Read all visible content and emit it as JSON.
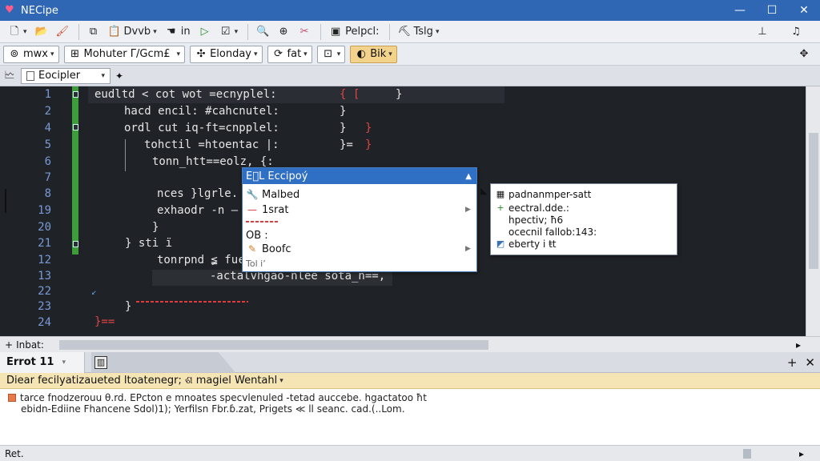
{
  "window": {
    "title": "NECipe",
    "controls": [
      "—",
      "☐",
      "✕"
    ]
  },
  "toolbar1": {
    "items": [
      {
        "icon": "new-file-icon",
        "glyph": "🗋",
        "caret": true
      },
      {
        "icon": "open-folder-icon",
        "glyph": "📂"
      },
      {
        "icon": "paint-icon",
        "glyph": "🖌"
      },
      {
        "icon": "copy-icon",
        "glyph": "⧉"
      },
      {
        "icon": "clipboard-icon",
        "glyph": "📋",
        "label": "Dvvb",
        "caret": true
      },
      {
        "icon": "hand-icon",
        "glyph": "☚",
        "label": "in"
      },
      {
        "icon": "run-icon",
        "glyph": "▷"
      },
      {
        "icon": "checklist-icon",
        "glyph": "☑",
        "caret": true
      },
      {
        "icon": "search-icon",
        "glyph": "🔍"
      },
      {
        "icon": "replace-icon",
        "glyph": "⊕"
      },
      {
        "icon": "tools-icon",
        "glyph": "✂"
      },
      {
        "icon": "panel-icon",
        "glyph": "▣",
        "label": "Pelpcl:"
      },
      {
        "icon": "build-icon",
        "glyph": "⛏",
        "label": "Tslg",
        "caret": true
      }
    ],
    "right_icons": [
      {
        "icon": "pin-icon",
        "glyph": "⊥"
      },
      {
        "icon": "music-icon",
        "glyph": "♫"
      }
    ]
  },
  "toolbar2": {
    "items": [
      {
        "icon": "target-icon",
        "glyph": "⊚",
        "label": "mwx",
        "caret": true
      },
      {
        "icon": "module-icon",
        "glyph": "⊞",
        "label": "Mohuter Γ/Gcm£",
        "caret": true
      },
      {
        "icon": "gear-icon",
        "glyph": "✣",
        "label": "Elonday",
        "caret": true
      },
      {
        "icon": "refresh-icon",
        "glyph": "⟳",
        "label": "fat",
        "caret": true
      },
      {
        "icon": "grid-icon",
        "glyph": "⊡",
        "caret": true
      },
      {
        "icon": "flame-icon",
        "glyph": "◐",
        "label": "Bik",
        "caret": true,
        "highlight": true
      }
    ],
    "right_icon": {
      "icon": "move-icon",
      "glyph": "✥"
    }
  },
  "tabs": {
    "left_icon": "🗠",
    "active": "Eocipler",
    "pin": "✦"
  },
  "editor": {
    "lines": [
      {
        "n": "1",
        "text": "eudltd < cot wot =ecnyplel:",
        "extra": "{ [",
        "extra2": "}"
      },
      {
        "n": "2",
        "text": "hacd encil: #cahcnutel:",
        "extra": "}"
      },
      {
        "n": "4",
        "text": "ordl cut iq-ft=cnpplel:",
        "extra": "}"
      },
      {
        "n": "5",
        "text": "tohctil =htoentac |:",
        "extra": "}="
      },
      {
        "n": "6",
        "text": "tonn_htt==eolz, {:",
        "extra": ""
      },
      {
        "n": "7",
        "text": "",
        "extra": ""
      },
      {
        "n": "8",
        "text": "nces }lgrle.",
        "extra": ""
      },
      {
        "n": "19",
        "text": "exhaodr -n —",
        "extra": ""
      },
      {
        "n": "20",
        "text": "}",
        "extra": ""
      },
      {
        "n": "21",
        "text": "} ѕti ï",
        "extra": ""
      },
      {
        "n": "12",
        "text": "tonrpnd ≨ fuє",
        "extra": ""
      },
      {
        "n": "13",
        "text": "-actalvhgao-nlee sota_n==,",
        "extra": ""
      },
      {
        "n": "22",
        "text": "",
        "extra": ""
      },
      {
        "n": "23",
        "text": "}",
        "extra": ""
      },
      {
        "n": "24",
        "text": "",
        "extra": ""
      },
      {
        "n": "",
        "text": "}==",
        "extra": ""
      }
    ]
  },
  "autocomplete": {
    "header": "E⃝L Eccipoý",
    "items": [
      {
        "icon": "wrench-icon",
        "glyph": "🔧",
        "label": "Malbed"
      },
      {
        "icon": "dash-icon",
        "glyph": "—",
        "label": "1srat",
        "submenu": true
      },
      {
        "icon": "",
        "glyph": "",
        "label": "OB :"
      },
      {
        "icon": "edit-icon",
        "glyph": "✎",
        "label": "Boofc",
        "submenu": true
      },
      {
        "icon": "",
        "glyph": "",
        "label": "Tol iʼ"
      }
    ]
  },
  "doc_tooltip": {
    "lines": [
      {
        "icon": "class-icon",
        "glyph": "▦",
        "text": "padnanmper-satt"
      },
      {
        "icon": "plus-icon",
        "glyph": "+",
        "text": "eectral.dde.:"
      },
      {
        "icon": "",
        "glyph": "",
        "text": "hpectiv; ħ6"
      },
      {
        "icon": "",
        "glyph": "",
        "text": "ocecnil fallob:143:"
      },
      {
        "icon": "method-icon",
        "glyph": "◩",
        "text": "eberty i ŧt"
      }
    ]
  },
  "hscroll": {
    "label": "Inbat:",
    "left_glyph": "+",
    "right_glyph": "▸"
  },
  "panel": {
    "tab": "Errot 11",
    "tab2_icon": "▥",
    "actions": [
      "+",
      "✕"
    ],
    "info": "Diear fecilyatizaueted ltoatenegr;  ଶ magiel Wentahl",
    "rows": [
      "tarce fnodzerouu θ.rd. EPcton e mnoates  specvlenuled -tetad auccebe. hgactatoo ħt",
      "ebidn-Ediine  Fhancene Sdol)1);  Yerfilsn  Fbr.ɓ.zat, Prigets ≪ ll seanc. cad.(..Lom."
    ]
  },
  "status": {
    "text": "Ret.",
    "right_glyph": "▸"
  }
}
